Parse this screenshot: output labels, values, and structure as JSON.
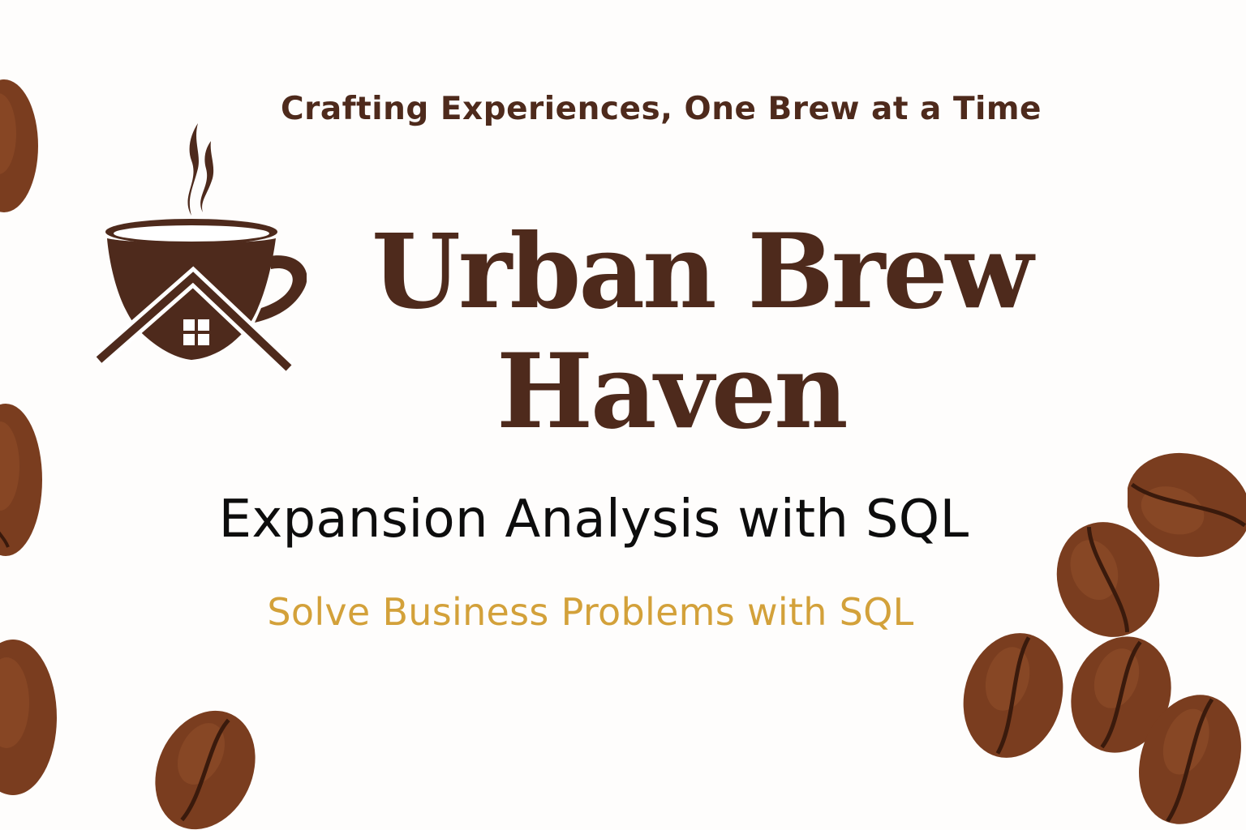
{
  "brand": {
    "tagline": "Crafting Experiences, One Brew at a Time",
    "name_line1": "Urban Brew",
    "name_line2": "Haven"
  },
  "headline": "Expansion Analysis with SQL",
  "subheadline": "Solve Business Problems with SQL",
  "colors": {
    "brand_brown": "#4e2a1c",
    "headline": "#0d0d0d",
    "accent_gold": "#d3a13a",
    "bean": "#7a3d1f",
    "background": "#fefdfc"
  },
  "icons": {
    "logo": "coffee-cup-house-icon",
    "decoration": "coffee-bean-icon"
  }
}
